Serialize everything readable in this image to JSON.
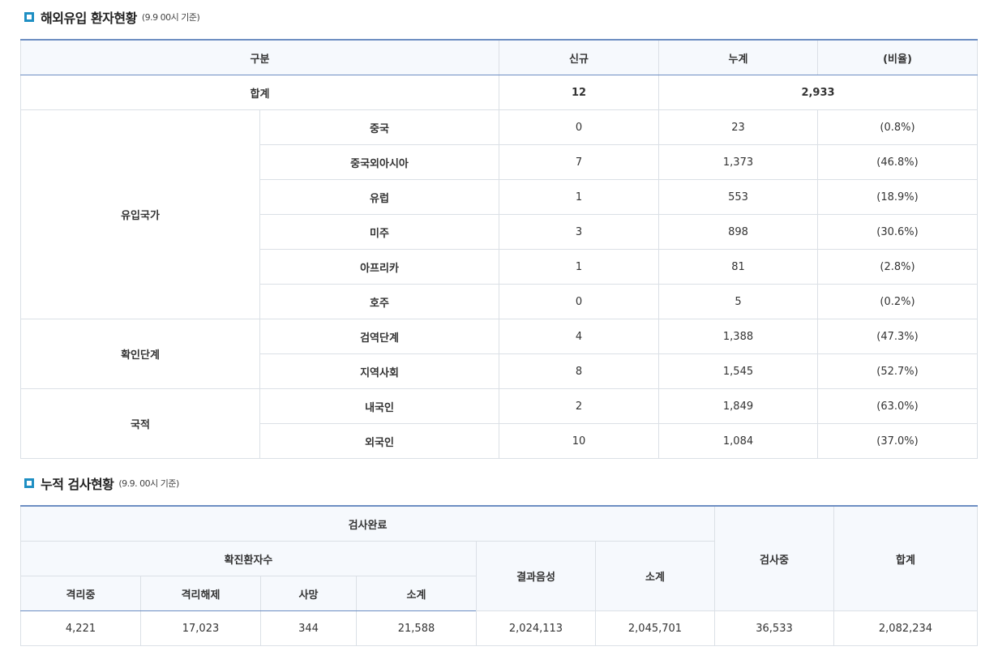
{
  "section1": {
    "title": "해외유입 환자현황",
    "subtitle": "(9.9 00시 기준)",
    "headers": {
      "category": "구분",
      "new": "신규",
      "cumulative": "누계",
      "ratio": "(비율)"
    },
    "total": {
      "label": "합계",
      "new": "12",
      "cumulative": "2,933"
    },
    "groups": [
      {
        "name": "유입국가",
        "rows": [
          {
            "label": "중국",
            "new": "0",
            "cumulative": "23",
            "ratio": "(0.8%)"
          },
          {
            "label": "중국외아시아",
            "new": "7",
            "cumulative": "1,373",
            "ratio": "(46.8%)"
          },
          {
            "label": "유럽",
            "new": "1",
            "cumulative": "553",
            "ratio": "(18.9%)"
          },
          {
            "label": "미주",
            "new": "3",
            "cumulative": "898",
            "ratio": "(30.6%)"
          },
          {
            "label": "아프리카",
            "new": "1",
            "cumulative": "81",
            "ratio": "(2.8%)"
          },
          {
            "label": "호주",
            "new": "0",
            "cumulative": "5",
            "ratio": "(0.2%)"
          }
        ]
      },
      {
        "name": "확인단계",
        "rows": [
          {
            "label": "검역단계",
            "new": "4",
            "cumulative": "1,388",
            "ratio": "(47.3%)"
          },
          {
            "label": "지역사회",
            "new": "8",
            "cumulative": "1,545",
            "ratio": "(52.7%)"
          }
        ]
      },
      {
        "name": "국적",
        "rows": [
          {
            "label": "내국인",
            "new": "2",
            "cumulative": "1,849",
            "ratio": "(63.0%)"
          },
          {
            "label": "외국인",
            "new": "10",
            "cumulative": "1,084",
            "ratio": "(37.0%)"
          }
        ]
      }
    ]
  },
  "section2": {
    "title": "누적 검사현황",
    "subtitle": "(9.9. 00시 기준)",
    "headers": {
      "completed": "검사완료",
      "confirmed": "확진환자수",
      "isolated": "격리중",
      "released": "격리해제",
      "deaths": "사망",
      "confirmed_subtotal": "소계",
      "negative": "결과음성",
      "completed_subtotal": "소계",
      "testing": "검사중",
      "total": "합계"
    },
    "values": {
      "isolated": "4,221",
      "released": "17,023",
      "deaths": "344",
      "confirmed_subtotal": "21,588",
      "negative": "2,024,113",
      "completed_subtotal": "2,045,701",
      "testing": "36,533",
      "total": "2,082,234"
    }
  },
  "colors": {
    "accent": "#1f8fc3",
    "table_border_top": "#6d8ec2",
    "header_bg": "#f6f9fd"
  }
}
